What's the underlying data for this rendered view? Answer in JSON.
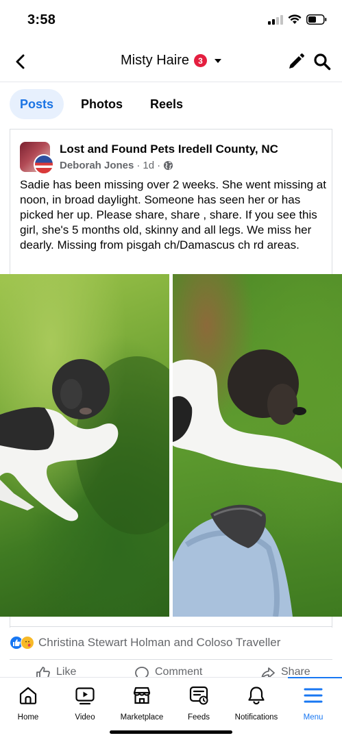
{
  "status": {
    "time": "3:58"
  },
  "nav": {
    "title": "Misty Haire",
    "badge": "3"
  },
  "tabs": [
    {
      "label": "Posts",
      "active": true
    },
    {
      "label": "Photos",
      "active": false
    },
    {
      "label": "Reels",
      "active": false
    }
  ],
  "post": {
    "group": "Lost and Found Pets Iredell County, NC",
    "author": "Deborah Jones",
    "time": "1d",
    "privacy_icon": "globe-icon",
    "text": "Sadie has been missing over 2 weeks.  She went missing at noon, in broad daylight.  Someone has seen her or has picked her up. Please share, share , share. If you see this girl, she's 5 months old,  skinny and all legs. We miss her dearly. Missing from pisgah ch/Damascus ch rd areas.",
    "reactions_text": "Christina Stewart Holman and Coloso Traveller",
    "actions": {
      "like": "Like",
      "comment": "Comment",
      "share": "Share"
    }
  },
  "bottom_nav": [
    {
      "label": "Home",
      "icon": "home-icon",
      "active": false
    },
    {
      "label": "Video",
      "icon": "video-icon",
      "active": false
    },
    {
      "label": "Marketplace",
      "icon": "marketplace-icon",
      "active": false
    },
    {
      "label": "Feeds",
      "icon": "feeds-icon",
      "active": false
    },
    {
      "label": "Notifications",
      "icon": "bell-icon",
      "active": false
    },
    {
      "label": "Menu",
      "icon": "menu-icon",
      "active": true
    }
  ],
  "colors": {
    "accent": "#1877f2",
    "badge": "#e41e3f",
    "active_tab_bg": "#e7f0fd",
    "secondary_text": "#65676b"
  }
}
